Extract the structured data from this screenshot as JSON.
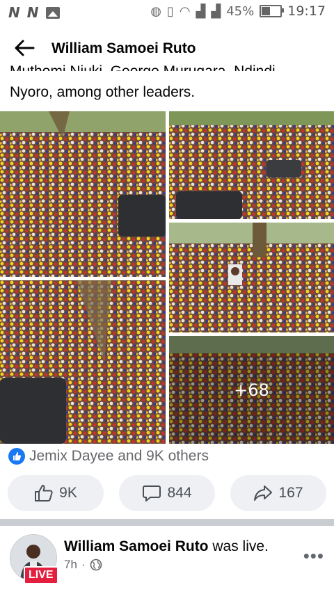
{
  "status_bar": {
    "left_icons": [
      "N",
      "N"
    ],
    "battery_percent": "45%",
    "battery_level": 0.45,
    "time": "19:17"
  },
  "header": {
    "title": "William Samoei Ruto"
  },
  "post": {
    "text_line_1": "Muthomi Njuki, George Murugara, Ndindi",
    "text_line_2": "Nyoro, among other leaders.",
    "more_photos_label": "+68"
  },
  "reactions": {
    "summary": "Jemix Dayee and 9K others"
  },
  "actions": {
    "like_count": "9K",
    "comment_count": "844",
    "share_count": "167"
  },
  "next_post": {
    "author": "William Samoei Ruto",
    "suffix": " was live.",
    "time": "7h",
    "separator": "·",
    "live_label": "LIVE"
  },
  "colors": {
    "accent": "#1877f2",
    "live": "#e41e3f"
  }
}
